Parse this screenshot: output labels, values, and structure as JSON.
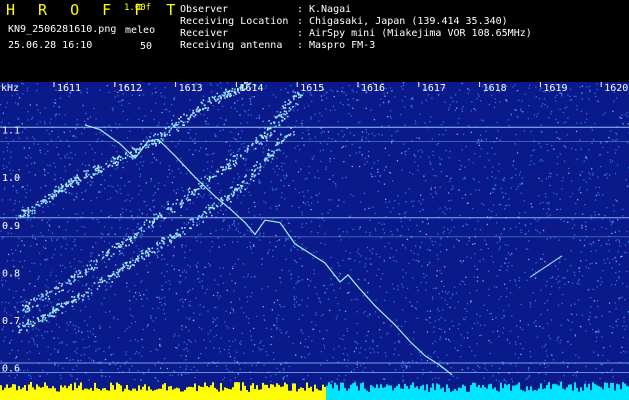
{
  "header": {
    "title": "H R O F F T",
    "version": "1.00f",
    "filename": "KN9_2506281610.png",
    "datetime": "25.06.28 16:10",
    "meleo_label": "meleo",
    "meleo_value": "50",
    "info": [
      {
        "label": "Observer",
        "value": "K.Nagai"
      },
      {
        "label": "Receiving Location",
        "value": "Chigasaki, Japan (139.414 35.340)"
      },
      {
        "label": "Receiver",
        "value": "AirSpy mini (Miakejima VOR 108.65MHz)"
      },
      {
        "label": "Receiving antenna",
        "value": "Maspro FM-3"
      }
    ]
  },
  "chart_data": {
    "type": "heatmap",
    "yunit": "kHz",
    "x_ticks": [
      "1611",
      "1612",
      "1613",
      "1614",
      "1615",
      "1616",
      "1617",
      "1618",
      "1619",
      "1620"
    ],
    "y_ticks": [
      {
        "label": "1.1",
        "value": 1.1
      },
      {
        "label": "1.0",
        "value": 1.0
      },
      {
        "label": "0.9",
        "value": 0.9
      },
      {
        "label": "0.8",
        "value": 0.8
      },
      {
        "label": "0.7",
        "value": 0.7
      },
      {
        "label": "0.6",
        "value": 0.6
      }
    ],
    "ylim": [
      0.57,
      1.2
    ],
    "colors": {
      "background": "#0a1a8a",
      "noise": "#2f6fe0",
      "trace": "#9ff0ff",
      "bottom_yellow": "#ffff00",
      "bottom_cyan": "#00e5ff",
      "grid": "#a8d8ff"
    }
  }
}
